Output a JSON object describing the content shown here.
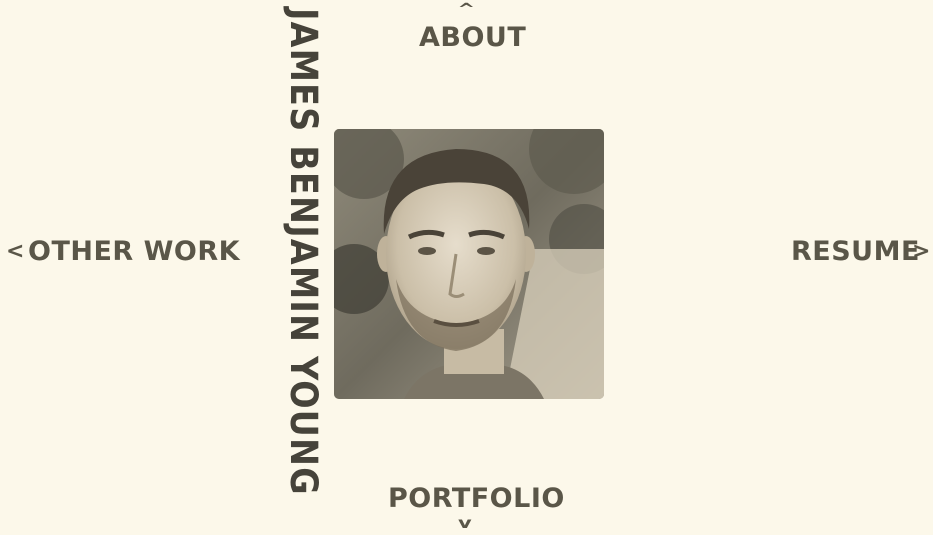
{
  "name": "JAMES BENJAMIN YOUNG",
  "nav": {
    "up": {
      "arrow": "^",
      "label": "ABOUT"
    },
    "down": {
      "arrow": "v",
      "label": "PORTFOLIO"
    },
    "left": {
      "arrow": "<",
      "label": "OTHER WORK"
    },
    "right": {
      "arrow": ">",
      "label": "RESUME"
    }
  },
  "portrait": {
    "icon": "profile-photo"
  },
  "colors": {
    "background": "#fcf8ea",
    "text": "#5a5648",
    "name_text": "#46433a"
  }
}
